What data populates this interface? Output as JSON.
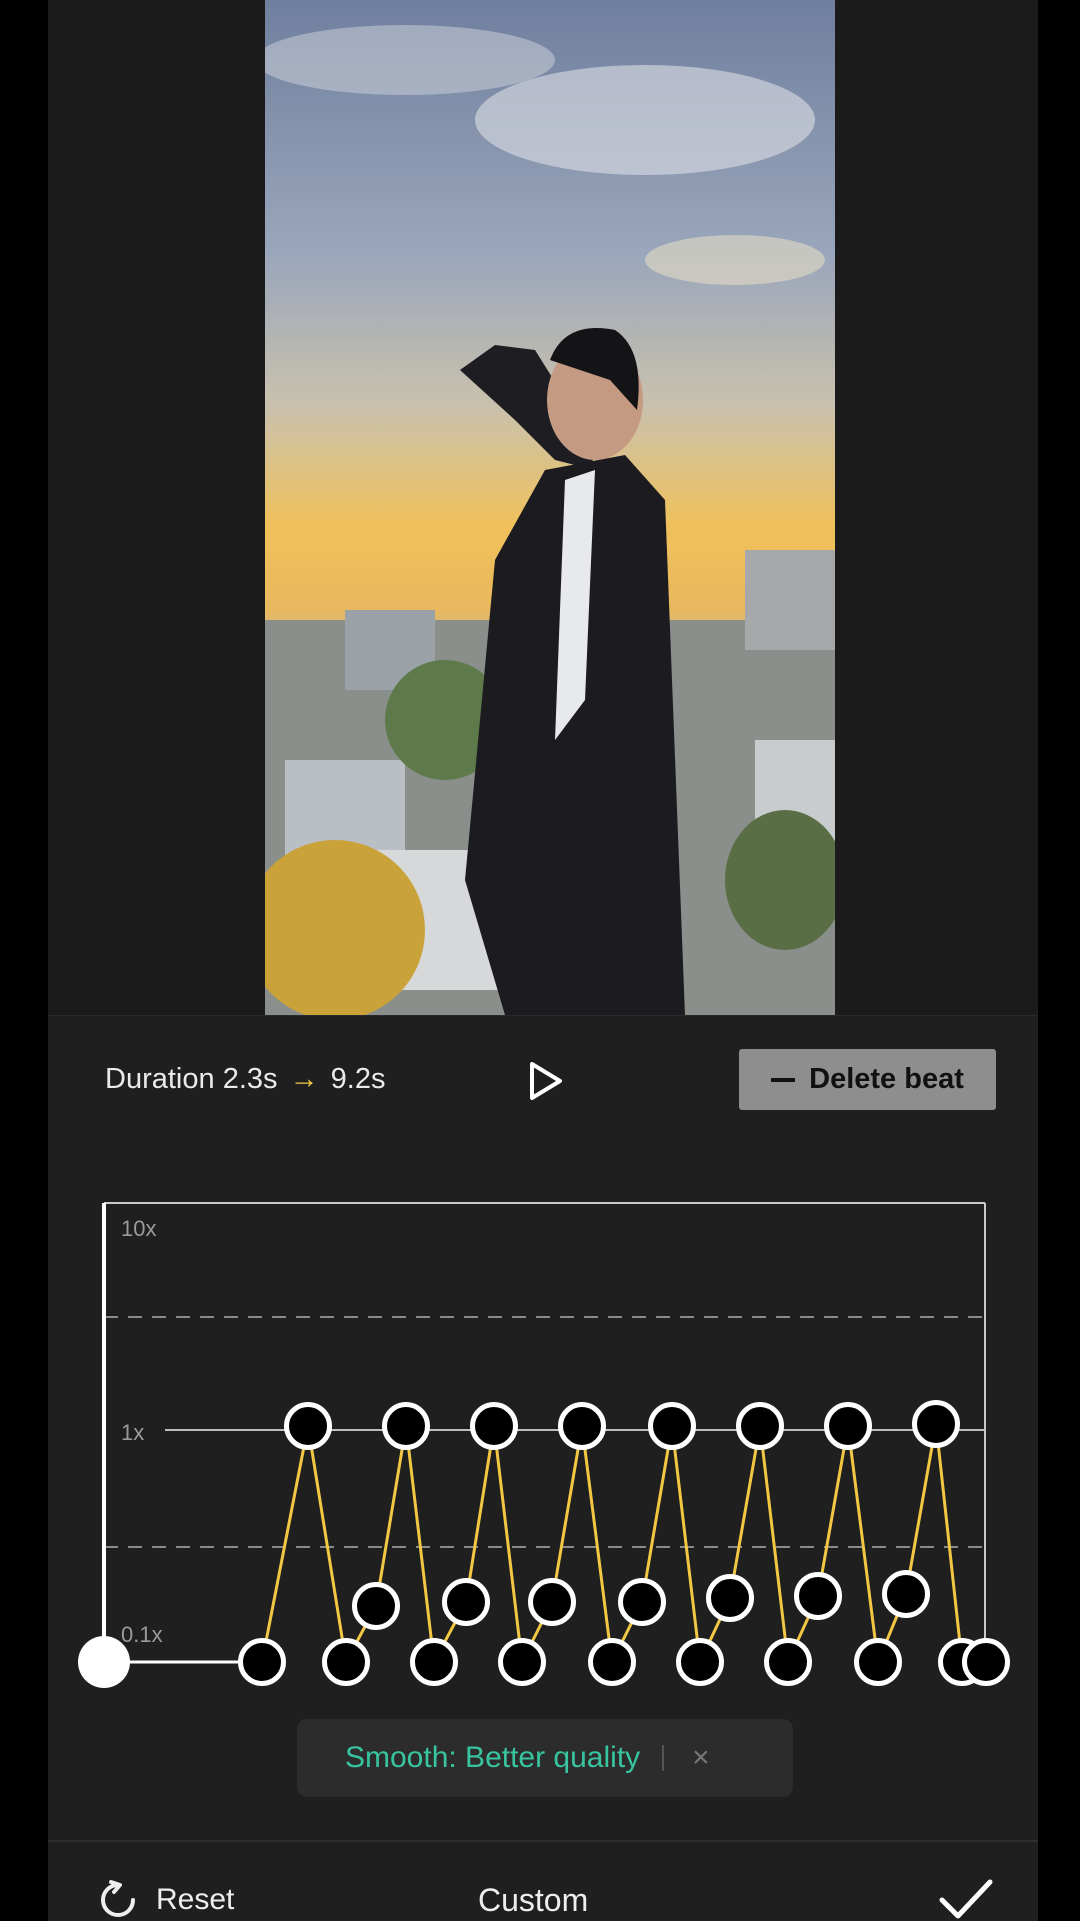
{
  "preview": {
    "image_description_icon": "photo-man-on-rooftop-sunset"
  },
  "header": {
    "duration_label": "Duration",
    "duration_from": "2.3s",
    "duration_arrow": "→",
    "duration_to": "9.2s",
    "delete_beat_label": "Delete beat"
  },
  "curve": {
    "tick_10x": "10x",
    "tick_1x": "1x",
    "tick_01x": "0.1x",
    "line_color": "#f2c744"
  },
  "toast": {
    "label": "Smooth: Better quality",
    "close": "×"
  },
  "footer": {
    "reset_label": "Reset",
    "title": "Custom"
  }
}
